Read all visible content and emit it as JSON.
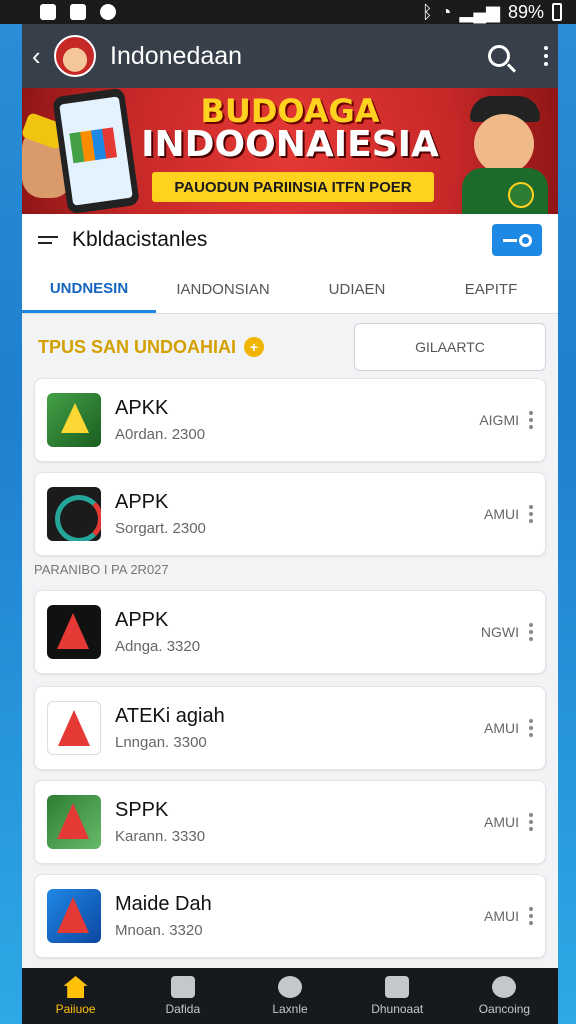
{
  "status_bar": {
    "battery": "89%"
  },
  "app_bar": {
    "title": "Indonedaan"
  },
  "banner": {
    "line1": "BUDOAGA",
    "line2": "INDOONAIESIA",
    "ribbon": "PAUODUN PARIINSIA ITFN POER"
  },
  "list_header": {
    "title": "Kbldacistanles"
  },
  "tabs": [
    {
      "label": "UNDNESIN",
      "active": true
    },
    {
      "label": "IANDONSIAN",
      "active": false
    },
    {
      "label": "UDIAEN",
      "active": false
    },
    {
      "label": "EAPITF",
      "active": false
    }
  ],
  "filter": {
    "label": "TPUS SAN UNDOAHIAI",
    "button": "GILAARTC"
  },
  "section_label": "PARANIBO I PA 2R027",
  "apps": [
    {
      "name": "APKK",
      "sub": "A0rdan. 2300",
      "badge": "AIGMI",
      "icon": "green-play-icon"
    },
    {
      "name": "APPK",
      "sub": "Sorgart. 2300",
      "badge": "AMUI",
      "icon": "dark-circle-icon"
    },
    {
      "name": "APPK",
      "sub": "Adnga. 3320",
      "badge": "NGWI",
      "icon": "dark-arrow-icon"
    },
    {
      "name": "ATEKi agiah",
      "sub": "Lnngan. 3300",
      "badge": "AMUI",
      "icon": "white-arrow-icon"
    },
    {
      "name": "SPPK",
      "sub": "Karann. 3330",
      "badge": "AMUI",
      "icon": "green-arrow-icon"
    },
    {
      "name": "Maide Dah",
      "sub": "Mnoan. 3320",
      "badge": "AMUI",
      "icon": "blue-arrow-icon"
    }
  ],
  "bottom_nav": [
    {
      "label": "Paiiuoe",
      "active": true
    },
    {
      "label": "Dafida",
      "active": false
    },
    {
      "label": "Laxnle",
      "active": false
    },
    {
      "label": "Dhunoaat",
      "active": false
    },
    {
      "label": "Oancoing",
      "active": false
    }
  ],
  "colors": {
    "accent": "#1e88e5",
    "appbar": "#37404a",
    "highlight": "#ffc107"
  }
}
